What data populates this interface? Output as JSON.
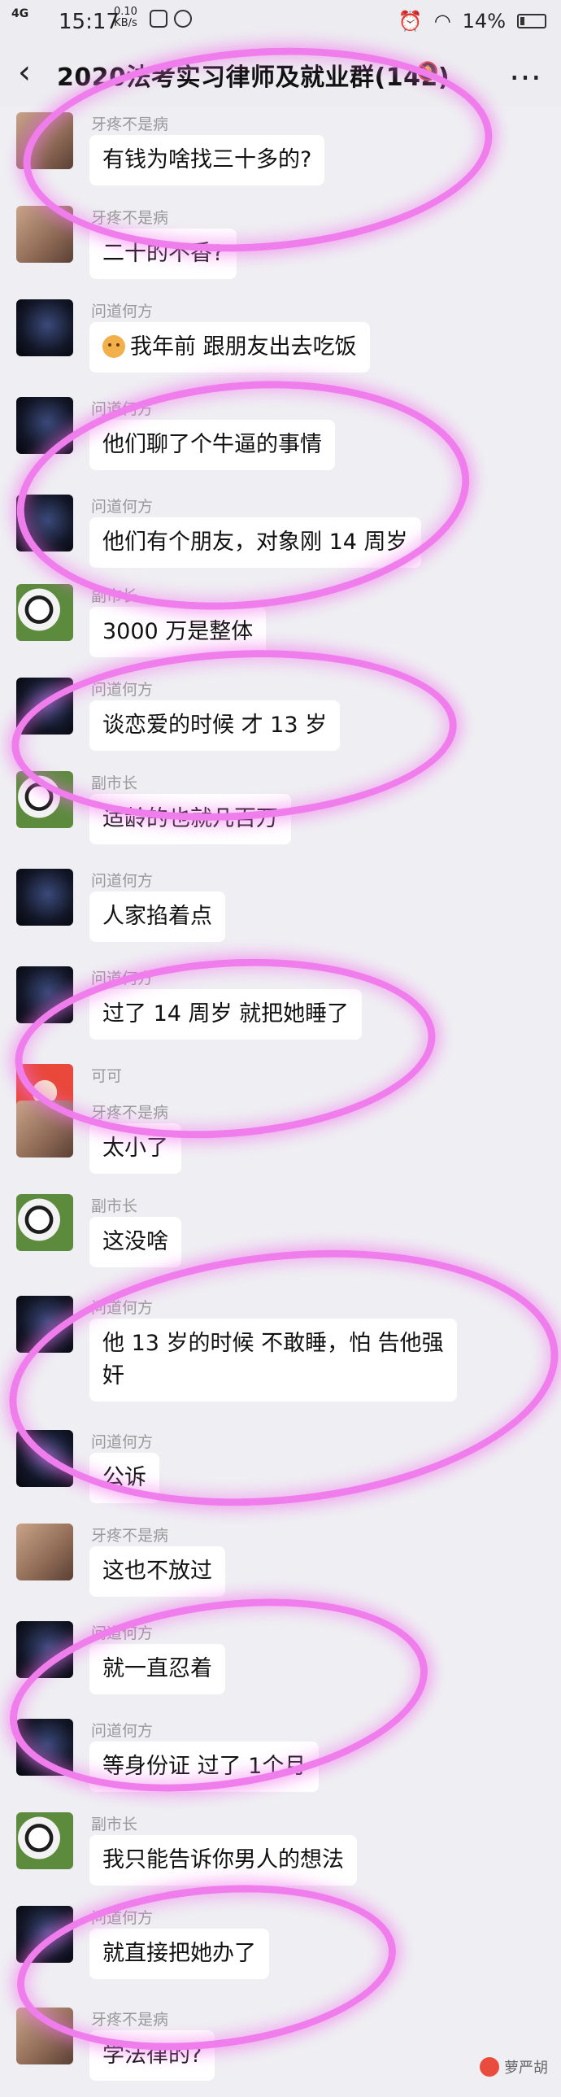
{
  "status_bar": {
    "signal": "4G",
    "time": "15:17",
    "net_speed": "0.10",
    "net_unit": "KB/s",
    "battery": "14%"
  },
  "header": {
    "back_icon": "chevron-left-icon",
    "title": "2020法考实习律师及就业群(142)",
    "mute_icon": "bell-mute-icon",
    "more": "…"
  },
  "messages": [
    {
      "nick": "牙疼不是病",
      "avatar": "tooth",
      "text": "有钱为啥找三十多的?"
    },
    {
      "nick": "牙疼不是病",
      "avatar": "tooth",
      "text": "二十的不香?"
    },
    {
      "nick": "问道何方",
      "avatar": "night",
      "text": "我年前 跟朋友出去吃饭"
    },
    {
      "nick": "问道何方",
      "avatar": "night",
      "text": "他们聊了个牛逼的事情"
    },
    {
      "nick": "问道何方",
      "avatar": "night",
      "text": "他们有个朋友，对象刚 14 周岁"
    },
    {
      "nick": "副市长",
      "avatar": "panda",
      "text": "3000 万是整体"
    },
    {
      "nick": "问道何方",
      "avatar": "night",
      "text": "谈恋爱的时候 才 13 岁"
    },
    {
      "nick": "副市长",
      "avatar": "panda",
      "text": "适龄的也就几百万"
    },
    {
      "nick": "问道何方",
      "avatar": "night",
      "text": "人家掐着点"
    },
    {
      "nick": "问道何方",
      "avatar": "night",
      "text": "过了 14 周岁 就把她睡了"
    },
    {
      "nick": "可可",
      "avatar": "keke",
      "text": ""
    },
    {
      "nick": "牙疼不是病",
      "avatar": "tooth",
      "text": "太小了"
    },
    {
      "nick": "副市长",
      "avatar": "panda",
      "text": "这没啥"
    },
    {
      "nick": "问道何方",
      "avatar": "night",
      "text": "他 13 岁的时候 不敢睡，怕 告他强\n奸"
    },
    {
      "nick": "问道何方",
      "avatar": "night",
      "text": "公诉"
    },
    {
      "nick": "牙疼不是病",
      "avatar": "tooth",
      "text": "这也不放过"
    },
    {
      "nick": "问道何方",
      "avatar": "night",
      "text": "就一直忍着"
    },
    {
      "nick": "问道何方",
      "avatar": "night",
      "text": "等身份证 过了 1个月"
    },
    {
      "nick": "副市长",
      "avatar": "panda",
      "text": "我只能告诉你男人的想法"
    },
    {
      "nick": "问道何方",
      "avatar": "night",
      "text": "就直接把她办了"
    },
    {
      "nick": "牙疼不是病",
      "avatar": "tooth",
      "text": "学法律的?"
    }
  ],
  "watermark": "萝严胡"
}
